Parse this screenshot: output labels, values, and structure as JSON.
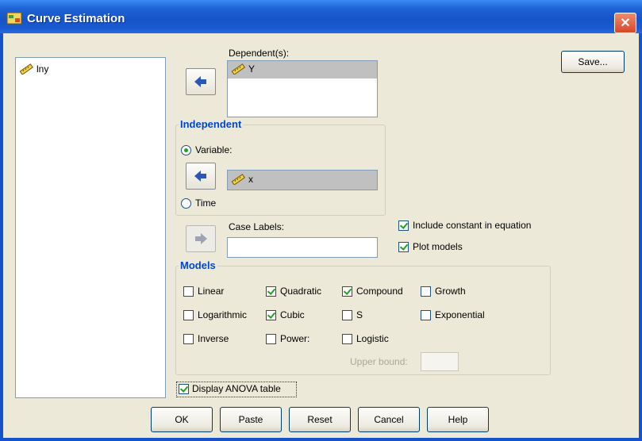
{
  "window": {
    "title": "Curve Estimation",
    "close_symbol": "✕"
  },
  "source_list": {
    "items": [
      {
        "icon": "ruler-icon",
        "label": "lny"
      }
    ]
  },
  "dependent": {
    "label": "Dependent(s):",
    "items": [
      {
        "icon": "ruler-icon",
        "label": "Y"
      }
    ]
  },
  "independent": {
    "title": "Independent",
    "variable_label": "Variable:",
    "variable_value": "x",
    "variable_selected": true,
    "time_label": "Time"
  },
  "case_labels": {
    "label": "Case Labels:",
    "value": ""
  },
  "options": {
    "include_constant": {
      "label": "Include constant in equation",
      "checked": true
    },
    "plot_models": {
      "label": "Plot models",
      "checked": true
    }
  },
  "models": {
    "title": "Models",
    "items": [
      {
        "label": "Linear",
        "checked": false
      },
      {
        "label": "Quadratic",
        "checked": true
      },
      {
        "label": "Compound",
        "checked": true
      },
      {
        "label": "Growth",
        "checked": false
      },
      {
        "label": "Logarithmic",
        "checked": false
      },
      {
        "label": "Cubic",
        "checked": true
      },
      {
        "label": "S",
        "checked": false
      },
      {
        "label": "Exponential",
        "checked": false
      },
      {
        "label": "Inverse",
        "checked": false
      },
      {
        "label": "Power:",
        "checked": false
      },
      {
        "label": "Logistic",
        "checked": false
      }
    ],
    "upper_bound_label": "Upper bound:",
    "upper_bound_value": ""
  },
  "display_anova": {
    "label": "Display ANOVA table",
    "checked": true
  },
  "buttons": {
    "save": "Save...",
    "ok": "OK",
    "paste": "Paste",
    "reset": "Reset",
    "cancel": "Cancel",
    "help": "Help"
  },
  "colors": {
    "title_bar": "#1553c8",
    "dialog_bg": "#ece9d8",
    "group_title": "#0046d5",
    "check_mark": "#21a121"
  }
}
